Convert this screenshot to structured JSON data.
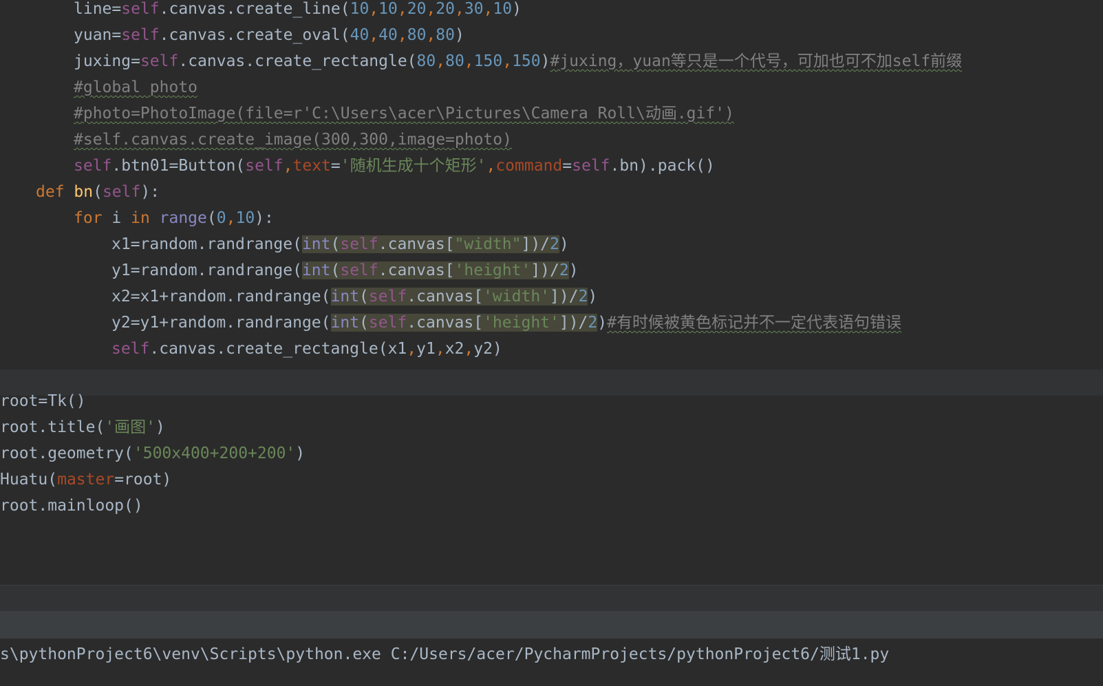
{
  "editor": {
    "lines": [
      {
        "segments": [
          {
            "t": "line",
            "c": "plain"
          },
          {
            "t": "=",
            "c": "plain"
          },
          {
            "t": "self",
            "c": "self"
          },
          {
            "t": ".canvas.create_line(",
            "c": "plain"
          },
          {
            "t": "10",
            "c": "num"
          },
          {
            "t": ",",
            "c": "kw"
          },
          {
            "t": "10",
            "c": "num"
          },
          {
            "t": ",",
            "c": "kw"
          },
          {
            "t": "20",
            "c": "num"
          },
          {
            "t": ",",
            "c": "kw"
          },
          {
            "t": "20",
            "c": "num"
          },
          {
            "t": ",",
            "c": "kw"
          },
          {
            "t": "30",
            "c": "num"
          },
          {
            "t": ",",
            "c": "kw"
          },
          {
            "t": "10",
            "c": "num"
          },
          {
            "t": ")",
            "c": "plain"
          }
        ]
      },
      {
        "segments": [
          {
            "t": "yuan",
            "c": "plain"
          },
          {
            "t": "=",
            "c": "plain"
          },
          {
            "t": "self",
            "c": "self"
          },
          {
            "t": ".canvas.create_oval(",
            "c": "plain"
          },
          {
            "t": "40",
            "c": "num"
          },
          {
            "t": ",",
            "c": "kw"
          },
          {
            "t": "40",
            "c": "num"
          },
          {
            "t": ",",
            "c": "kw"
          },
          {
            "t": "80",
            "c": "num"
          },
          {
            "t": ",",
            "c": "kw"
          },
          {
            "t": "80",
            "c": "num"
          },
          {
            "t": ")",
            "c": "plain"
          }
        ]
      },
      {
        "segments": [
          {
            "t": "juxing",
            "c": "plain"
          },
          {
            "t": "=",
            "c": "plain"
          },
          {
            "t": "self",
            "c": "self"
          },
          {
            "t": ".canvas.create_rectangle(",
            "c": "plain"
          },
          {
            "t": "80",
            "c": "num"
          },
          {
            "t": ",",
            "c": "kw"
          },
          {
            "t": "80",
            "c": "num"
          },
          {
            "t": ",",
            "c": "kw"
          },
          {
            "t": "150",
            "c": "num"
          },
          {
            "t": ",",
            "c": "kw"
          },
          {
            "t": "150",
            "c": "num"
          },
          {
            "t": ")",
            "c": "plain"
          },
          {
            "t": "#juxing，yuan等只是一个代号，可加也可不加self前缀",
            "c": "cm"
          }
        ]
      },
      {
        "segments": [
          {
            "t": "#global photo",
            "c": "cm"
          }
        ]
      },
      {
        "segments": [
          {
            "t": "#photo=PhotoImage(file=r'C:\\Users\\acer\\Pictures\\Camera Roll\\动画.gif')",
            "c": "cm"
          }
        ]
      },
      {
        "segments": [
          {
            "t": "#self.canvas.create_image(300,300,image=photo)",
            "c": "cm"
          }
        ]
      },
      {
        "segments": [
          {
            "t": "self",
            "c": "self"
          },
          {
            "t": ".btn01=Button(",
            "c": "plain"
          },
          {
            "t": "self",
            "c": "self"
          },
          {
            "t": ",",
            "c": "kw"
          },
          {
            "t": "text",
            "c": "param"
          },
          {
            "t": "=",
            "c": "plain"
          },
          {
            "t": "'随机生成十个矩形'",
            "c": "str"
          },
          {
            "t": ",",
            "c": "kw"
          },
          {
            "t": "command",
            "c": "param"
          },
          {
            "t": "=",
            "c": "plain"
          },
          {
            "t": "self",
            "c": "self"
          },
          {
            "t": ".bn).pack()",
            "c": "plain"
          }
        ]
      },
      {
        "segments": [
          {
            "t": "def ",
            "c": "kw"
          },
          {
            "t": "bn",
            "c": "fn"
          },
          {
            "t": "(",
            "c": "plain"
          },
          {
            "t": "self",
            "c": "self"
          },
          {
            "t": "):",
            "c": "plain"
          }
        ]
      },
      {
        "segments": [
          {
            "t": "for ",
            "c": "kw"
          },
          {
            "t": "i ",
            "c": "plain"
          },
          {
            "t": "in ",
            "c": "kw"
          },
          {
            "t": "range",
            "c": "builtin"
          },
          {
            "t": "(",
            "c": "plain"
          },
          {
            "t": "0",
            "c": "num"
          },
          {
            "t": ",",
            "c": "kw"
          },
          {
            "t": "10",
            "c": "num"
          },
          {
            "t": "):",
            "c": "plain"
          }
        ]
      },
      {
        "segments": [
          {
            "t": "x1=random.randrange(",
            "c": "plain"
          },
          {
            "t": "int",
            "c": "builtin"
          },
          {
            "t": "(",
            "c": "plain"
          },
          {
            "t": "self",
            "c": "self"
          },
          {
            "t": ".canvas[",
            "c": "plain"
          },
          {
            "t": "\"width\"",
            "c": "str"
          },
          {
            "t": "])/",
            "c": "plain"
          },
          {
            "t": "2",
            "c": "num"
          },
          {
            "t": ")",
            "c": "plain"
          }
        ]
      },
      {
        "segments": [
          {
            "t": "y1=random.randrange(",
            "c": "plain"
          },
          {
            "t": "int",
            "c": "builtin"
          },
          {
            "t": "(",
            "c": "plain"
          },
          {
            "t": "self",
            "c": "self"
          },
          {
            "t": ".canvas[",
            "c": "plain"
          },
          {
            "t": "'height'",
            "c": "str"
          },
          {
            "t": "])/",
            "c": "plain"
          },
          {
            "t": "2",
            "c": "num"
          },
          {
            "t": ")",
            "c": "plain"
          }
        ]
      },
      {
        "segments": [
          {
            "t": "x2=x1+random.randrange(",
            "c": "plain"
          },
          {
            "t": "int",
            "c": "builtin"
          },
          {
            "t": "(",
            "c": "plain"
          },
          {
            "t": "self",
            "c": "self"
          },
          {
            "t": ".canvas[",
            "c": "plain"
          },
          {
            "t": "'width'",
            "c": "str"
          },
          {
            "t": "])/",
            "c": "plain"
          },
          {
            "t": "2",
            "c": "num"
          },
          {
            "t": ")",
            "c": "plain"
          }
        ]
      },
      {
        "segments": [
          {
            "t": "y2=y1+random.randrange(",
            "c": "plain"
          },
          {
            "t": "int",
            "c": "builtin"
          },
          {
            "t": "(",
            "c": "plain"
          },
          {
            "t": "self",
            "c": "self"
          },
          {
            "t": ".canvas[",
            "c": "plain"
          },
          {
            "t": "'height'",
            "c": "str"
          },
          {
            "t": "])/",
            "c": "plain"
          },
          {
            "t": "2",
            "c": "num"
          },
          {
            "t": ")",
            "c": "plain"
          },
          {
            "t": "#有时候被黄色标记并不一定代表语句错误",
            "c": "cm"
          }
        ]
      },
      {
        "segments": [
          {
            "t": "self",
            "c": "self"
          },
          {
            "t": ".canvas.create_rectangle(x1",
            "c": "plain"
          },
          {
            "t": ",",
            "c": "kw"
          },
          {
            "t": "y1",
            "c": "plain"
          },
          {
            "t": ",",
            "c": "kw"
          },
          {
            "t": "x2",
            "c": "plain"
          },
          {
            "t": ",",
            "c": "kw"
          },
          {
            "t": "y2)",
            "c": "plain"
          }
        ]
      },
      {
        "segments": []
      },
      {
        "segments": [
          {
            "t": "root=Tk()",
            "c": "plain"
          }
        ]
      },
      {
        "segments": [
          {
            "t": "root.title(",
            "c": "plain"
          },
          {
            "t": "'画图'",
            "c": "str"
          },
          {
            "t": ")",
            "c": "plain"
          }
        ]
      },
      {
        "segments": [
          {
            "t": "root.geometry(",
            "c": "plain"
          },
          {
            "t": "'500x400+200+200'",
            "c": "str"
          },
          {
            "t": ")",
            "c": "plain"
          }
        ]
      },
      {
        "segments": [
          {
            "t": "Huatu(",
            "c": "plain"
          },
          {
            "t": "master",
            "c": "param"
          },
          {
            "t": "=root)",
            "c": "plain"
          }
        ]
      },
      {
        "segments": [
          {
            "t": "root.mainloop()",
            "c": "plain"
          }
        ]
      }
    ]
  },
  "console": {
    "command": "s\\pythonProject6\\venv\\Scripts\\python.exe C:/Users/acer/PycharmProjects/pythonProject6/测试1.py"
  },
  "colors": {
    "background": "#2b2b2b",
    "keyword": "#cc7832",
    "self": "#94558d",
    "number": "#6897bb",
    "string": "#6a8759",
    "comment": "#808080",
    "parameter": "#aa4926",
    "function": "#ffc66d"
  }
}
